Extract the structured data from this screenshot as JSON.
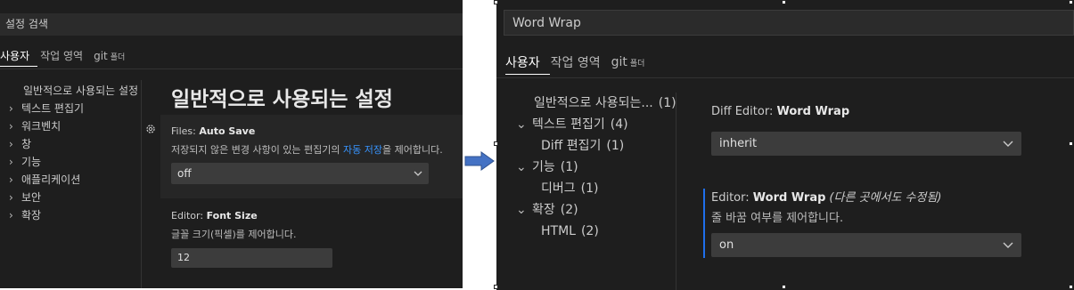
{
  "left_panel": {
    "search": {
      "placeholder": "설정 검색"
    },
    "tabs": [
      {
        "label": "사용자"
      },
      {
        "label": "작업 영역"
      },
      {
        "label": "git",
        "suffix": "폴더"
      }
    ],
    "toc": [
      {
        "label": "일반적으로 사용되는 설정",
        "chevron": ""
      },
      {
        "label": "텍스트 편집기",
        "chevron": "›"
      },
      {
        "label": "워크벤치",
        "chevron": "›"
      },
      {
        "label": "창",
        "chevron": "›"
      },
      {
        "label": "기능",
        "chevron": "›"
      },
      {
        "label": "애플리케이션",
        "chevron": "›"
      },
      {
        "label": "보안",
        "chevron": "›"
      },
      {
        "label": "확장",
        "chevron": "›"
      }
    ],
    "section_title": "일반적으로 사용되는 설정",
    "settings": {
      "auto_save": {
        "category": "Files: ",
        "name": "Auto Save",
        "description_before": "저장되지 않은 변경 사항이 있는 편집기의 ",
        "description_link": "자동 저장",
        "description_after": "을 제어합니다.",
        "value": "off"
      },
      "font_size": {
        "category": "Editor: ",
        "name": "Font Size",
        "description": "글꼴 크기(픽셀)를 제어합니다.",
        "value": "12"
      }
    }
  },
  "right_panel": {
    "search": {
      "value": "Word Wrap"
    },
    "tabs": [
      {
        "label": "사용자"
      },
      {
        "label": "작업 영역"
      },
      {
        "label": "git",
        "suffix": "폴더"
      }
    ],
    "toc": [
      {
        "label": "일반적으로 사용되는...",
        "count": "(1)",
        "chevron": ""
      },
      {
        "label": "텍스트 편집기",
        "count": "(4)",
        "chevron": "⌄"
      },
      {
        "label": "Diff 편집기",
        "count": "(1)",
        "chevron": ""
      },
      {
        "label": "기능",
        "count": "(1)",
        "chevron": "⌄"
      },
      {
        "label": "디버그",
        "count": "(1)",
        "chevron": ""
      },
      {
        "label": "확장",
        "count": "(2)",
        "chevron": "⌄"
      },
      {
        "label": "HTML",
        "count": "(2)",
        "chevron": ""
      }
    ],
    "settings": {
      "diff_word_wrap": {
        "category": "Diff Editor: ",
        "name": "Word Wrap",
        "value": "inherit"
      },
      "editor_word_wrap": {
        "category": "Editor: ",
        "name": "Word Wrap",
        "note": "(다른 곳에서도 수정됨)",
        "description": "줄 바꿈 여부를 제어합니다.",
        "value": "on"
      }
    }
  },
  "colors": {
    "background": "#1e1e1e",
    "link": "#3794ff",
    "modified_bar": "#1f6feb",
    "arrow": "#4472c4"
  },
  "icons": {
    "gear": "settings-gear-icon",
    "chevron": "chevron-down-icon",
    "arrow": "right-arrow-icon"
  }
}
